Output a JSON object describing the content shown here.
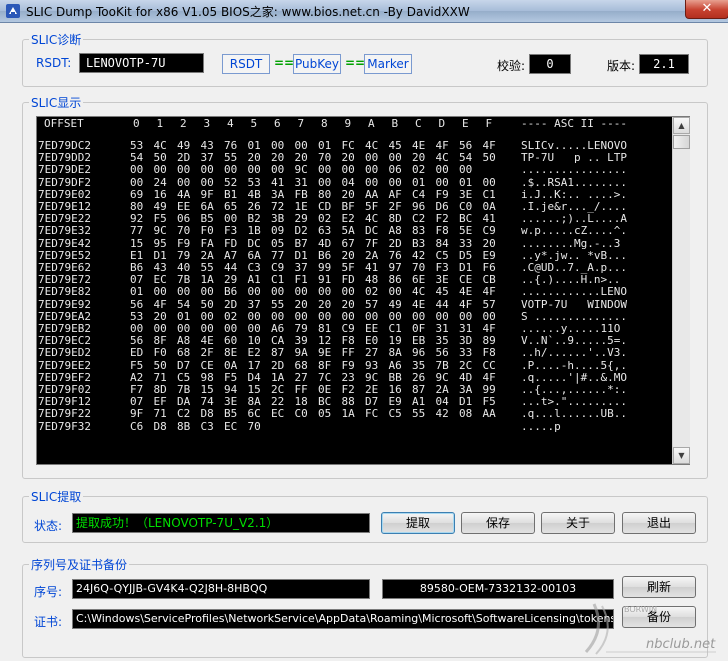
{
  "window": {
    "title": "SLIC Dump TooKit for x86 V1.05      BIOS之家: www.bios.net.cn   -By DavidXXW",
    "close_glyph": "✕"
  },
  "slic_diag": {
    "group_title": "SLIC诊断",
    "rsdt_label": "RSDT:",
    "rsdt_value": "LENOVOTP-7U",
    "btn_rsdt": "RSDT",
    "btn_pubkey": "PubKey",
    "btn_marker": "Marker",
    "eq": "==",
    "checksum_label": "校验:",
    "checksum_value": "0",
    "version_label": "版本:",
    "version_value": "2.1"
  },
  "slic_view": {
    "group_title": "SLIC显示",
    "header": {
      "offset": "OFFSET",
      "cols": [
        "0",
        "1",
        "2",
        "3",
        "4",
        "5",
        "6",
        "7",
        "8",
        "9",
        "A",
        "B",
        "C",
        "D",
        "E",
        "F"
      ],
      "ascii": "---- ASC II ----"
    },
    "rows": [
      {
        "offset": "7ED79DC2",
        "bytes": [
          "53",
          "4C",
          "49",
          "43",
          "76",
          "01",
          "00",
          "00",
          "01",
          "FC",
          "4C",
          "45",
          "4E",
          "4F",
          "56",
          "4F"
        ],
        "ascii": "SLICv.....LENOVO"
      },
      {
        "offset": "7ED79DD2",
        "bytes": [
          "54",
          "50",
          "2D",
          "37",
          "55",
          "20",
          "20",
          "20",
          "70",
          "20",
          "00",
          "00",
          "20",
          "4C",
          "54",
          "50"
        ],
        "ascii": "TP-7U   p .. LTP"
      },
      {
        "offset": "7ED79DE2",
        "bytes": [
          "00",
          "00",
          "00",
          "00",
          "00",
          "00",
          "00",
          "9C",
          "00",
          "00",
          "00",
          "06",
          "02",
          "00",
          "00"
        ],
        "ascii": "................"
      },
      {
        "offset": "7ED79DF2",
        "bytes": [
          "00",
          "24",
          "00",
          "00",
          "52",
          "53",
          "41",
          "31",
          "00",
          "04",
          "00",
          "00",
          "01",
          "00",
          "01",
          "00"
        ],
        "ascii": ".$..RSA1........"
      },
      {
        "offset": "7ED79E02",
        "bytes": [
          "69",
          "16",
          "4A",
          "9F",
          "B1",
          "4B",
          "3A",
          "FB",
          "80",
          "20",
          "AA",
          "AF",
          "C4",
          "F9",
          "3E",
          "C1"
        ],
        "ascii": "i.J..K:.. ....>."
      },
      {
        "offset": "7ED79E12",
        "bytes": [
          "80",
          "49",
          "EE",
          "6A",
          "65",
          "26",
          "72",
          "1E",
          "CD",
          "BF",
          "5F",
          "2F",
          "96",
          "D6",
          "C0",
          "0A"
        ],
        "ascii": ".I.je&r..._/...."
      },
      {
        "offset": "7ED79E22",
        "bytes": [
          "92",
          "F5",
          "06",
          "B5",
          "00",
          "B2",
          "3B",
          "29",
          "02",
          "E2",
          "4C",
          "8D",
          "C2",
          "F2",
          "BC",
          "41"
        ],
        "ascii": "......;)..L....A"
      },
      {
        "offset": "7ED79E32",
        "bytes": [
          "77",
          "9C",
          "70",
          "F0",
          "F3",
          "1B",
          "09",
          "D2",
          "63",
          "5A",
          "DC",
          "A8",
          "83",
          "F8",
          "5E",
          "C9"
        ],
        "ascii": "w.p.....cZ....^."
      },
      {
        "offset": "7ED79E42",
        "bytes": [
          "15",
          "95",
          "F9",
          "FA",
          "FD",
          "DC",
          "05",
          "B7",
          "4D",
          "67",
          "7F",
          "2D",
          "B3",
          "84",
          "33",
          "20"
        ],
        "ascii": "........Mg.-..3 "
      },
      {
        "offset": "7ED79E52",
        "bytes": [
          "E1",
          "D1",
          "79",
          "2A",
          "A7",
          "6A",
          "77",
          "D1",
          "B6",
          "20",
          "2A",
          "76",
          "42",
          "C5",
          "D5",
          "E9"
        ],
        "ascii": "..y*.jw.. *vB..."
      },
      {
        "offset": "7ED79E62",
        "bytes": [
          "B6",
          "43",
          "40",
          "55",
          "44",
          "C3",
          "C9",
          "37",
          "99",
          "5F",
          "41",
          "97",
          "70",
          "F3",
          "D1",
          "F6"
        ],
        "ascii": ".C@UD..7._A.p..."
      },
      {
        "offset": "7ED79E72",
        "bytes": [
          "07",
          "EC",
          "7B",
          "1A",
          "29",
          "A1",
          "C1",
          "F1",
          "91",
          "FD",
          "48",
          "86",
          "6E",
          "3E",
          "CE",
          "CB"
        ],
        "ascii": "..{.)....H.n>.."
      },
      {
        "offset": "7ED79E82",
        "bytes": [
          "01",
          "00",
          "00",
          "00",
          "B6",
          "00",
          "00",
          "00",
          "00",
          "00",
          "02",
          "00",
          "4C",
          "45",
          "4E",
          "4F"
        ],
        "ascii": "............LENO"
      },
      {
        "offset": "7ED79E92",
        "bytes": [
          "56",
          "4F",
          "54",
          "50",
          "2D",
          "37",
          "55",
          "20",
          "20",
          "20",
          "57",
          "49",
          "4E",
          "44",
          "4F",
          "57"
        ],
        "ascii": "VOTP-7U   WINDOW"
      },
      {
        "offset": "7ED79EA2",
        "bytes": [
          "53",
          "20",
          "01",
          "00",
          "02",
          "00",
          "00",
          "00",
          "00",
          "00",
          "00",
          "00",
          "00",
          "00",
          "00",
          "00"
        ],
        "ascii": "S .............."
      },
      {
        "offset": "7ED79EB2",
        "bytes": [
          "00",
          "00",
          "00",
          "00",
          "00",
          "00",
          "A6",
          "79",
          "81",
          "C9",
          "EE",
          "C1",
          "0F",
          "31",
          "31",
          "4F"
        ],
        "ascii": "......y.....11O"
      },
      {
        "offset": "7ED79EC2",
        "bytes": [
          "56",
          "8F",
          "A8",
          "4E",
          "60",
          "10",
          "CA",
          "39",
          "12",
          "F8",
          "E0",
          "19",
          "EB",
          "35",
          "3D",
          "89"
        ],
        "ascii": "V..N`..9.....5=."
      },
      {
        "offset": "7ED79ED2",
        "bytes": [
          "ED",
          "F0",
          "68",
          "2F",
          "8E",
          "E2",
          "87",
          "9A",
          "9E",
          "FF",
          "27",
          "8A",
          "96",
          "56",
          "33",
          "F8"
        ],
        "ascii": "..h/......'..V3."
      },
      {
        "offset": "7ED79EE2",
        "bytes": [
          "F5",
          "50",
          "D7",
          "CE",
          "0A",
          "17",
          "2D",
          "68",
          "8F",
          "F9",
          "93",
          "A6",
          "35",
          "7B",
          "2C",
          "CC"
        ],
        "ascii": ".P....-h....5{,."
      },
      {
        "offset": "7ED79EF2",
        "bytes": [
          "A2",
          "71",
          "C5",
          "98",
          "F5",
          "D4",
          "1A",
          "27",
          "7C",
          "23",
          "9C",
          "BB",
          "26",
          "9C",
          "4D",
          "4F"
        ],
        "ascii": ".q.....'|#..&.MO"
      },
      {
        "offset": "7ED79F02",
        "bytes": [
          "F7",
          "8D",
          "7B",
          "15",
          "94",
          "15",
          "2C",
          "FF",
          "0E",
          "F2",
          "2E",
          "16",
          "87",
          "2A",
          "3A",
          "99"
        ],
        "ascii": "..{...,......*:."
      },
      {
        "offset": "7ED79F12",
        "bytes": [
          "07",
          "EF",
          "DA",
          "74",
          "3E",
          "8A",
          "22",
          "18",
          "BC",
          "88",
          "D7",
          "E9",
          "A1",
          "04",
          "D1",
          "F5"
        ],
        "ascii": "...t>.\"........."
      },
      {
        "offset": "7ED79F22",
        "bytes": [
          "9F",
          "71",
          "C2",
          "D8",
          "B5",
          "6C",
          "EC",
          "C0",
          "05",
          "1A",
          "FC",
          "C5",
          "55",
          "42",
          "08",
          "AA"
        ],
        "ascii": ".q...l......UB.."
      },
      {
        "offset": "7ED79F32",
        "bytes": [
          "C6",
          "D8",
          "8B",
          "C3",
          "EC",
          "70"
        ],
        "ascii": ".....p"
      }
    ]
  },
  "slic_extract": {
    "group_title": "SLIC提取",
    "status_label": "状态:",
    "status_value": "提取成功！（LENOVOTP-7U_V2.1）",
    "btn_extract": "提取",
    "btn_save": "保存",
    "btn_about": "关于",
    "btn_exit": "退出"
  },
  "backup": {
    "group_title": "序列号及证书备份",
    "serial_label": "序号:",
    "serial_value": "24J6Q-QYJJB-GV4K4-Q2J8H-8HBQQ",
    "product_id": "89580-OEM-7332132-00103",
    "btn_refresh": "刷新",
    "cert_label": "证书:",
    "cert_path": "C:\\Windows\\ServiceProfiles\\NetworkService\\AppData\\Roaming\\Microsoft\\SoftwareLicensing\\tokens.dat",
    "btn_backup": "备份"
  },
  "watermark": {
    "site": "nbclub.net",
    "tag": "BORWIN"
  }
}
